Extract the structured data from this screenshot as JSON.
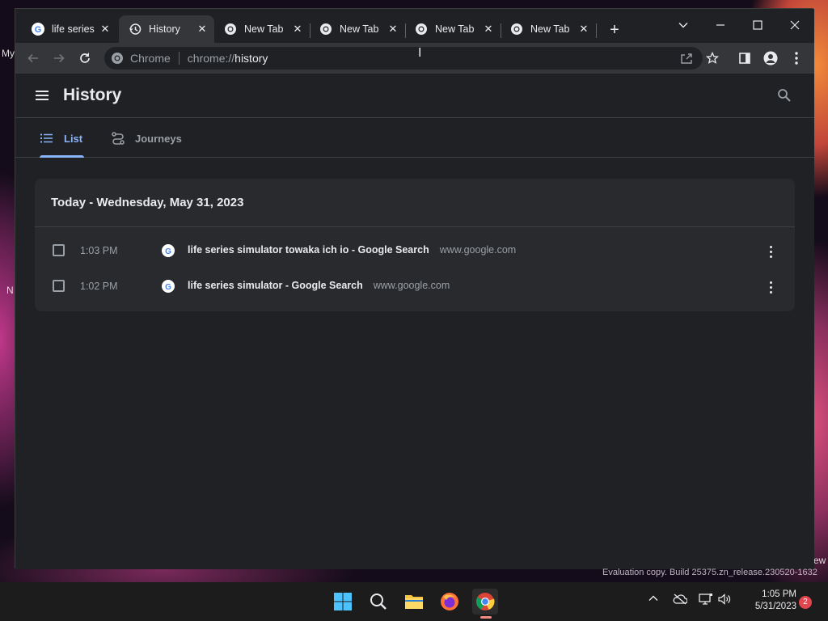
{
  "desktop": {
    "left_texts": [
      "My",
      "N"
    ],
    "right_text": "ew",
    "watermark": "Evaluation copy. Build 25375.zn_release.230520-1632"
  },
  "tabs": [
    {
      "title": "life series",
      "icon": "google-g-icon",
      "active": false
    },
    {
      "title": "History",
      "icon": "history-icon",
      "active": true
    },
    {
      "title": "New Tab",
      "icon": "chrome-icon",
      "active": false
    },
    {
      "title": "New Tab",
      "icon": "chrome-icon",
      "active": false
    },
    {
      "title": "New Tab",
      "icon": "chrome-icon",
      "active": false
    },
    {
      "title": "New Tab",
      "icon": "chrome-icon",
      "active": false
    }
  ],
  "omnibox": {
    "chip": "Chrome",
    "url_prefix": "chrome://",
    "url_path": "history"
  },
  "history": {
    "title": "History",
    "tabs": {
      "list": "List",
      "journeys": "Journeys"
    },
    "day_header": "Today - Wednesday, May 31, 2023",
    "entries": [
      {
        "time": "1:03 PM",
        "title": "life series simulator towaka ich io - Google Search",
        "domain": "www.google.com"
      },
      {
        "time": "1:02 PM",
        "title": "life series simulator - Google Search",
        "domain": "www.google.com"
      }
    ]
  },
  "taskbar": {
    "apps": [
      "windows-start-icon",
      "search-icon",
      "file-explorer-icon",
      "firefox-icon",
      "chrome-icon"
    ],
    "clock_time": "1:05 PM",
    "clock_date": "5/31/2023",
    "notification_count": "2"
  },
  "colors": {
    "accent": "#8ab4f8",
    "page_bg": "#202124",
    "card_bg": "#292a2d",
    "toolbar_bg": "#35363a"
  }
}
